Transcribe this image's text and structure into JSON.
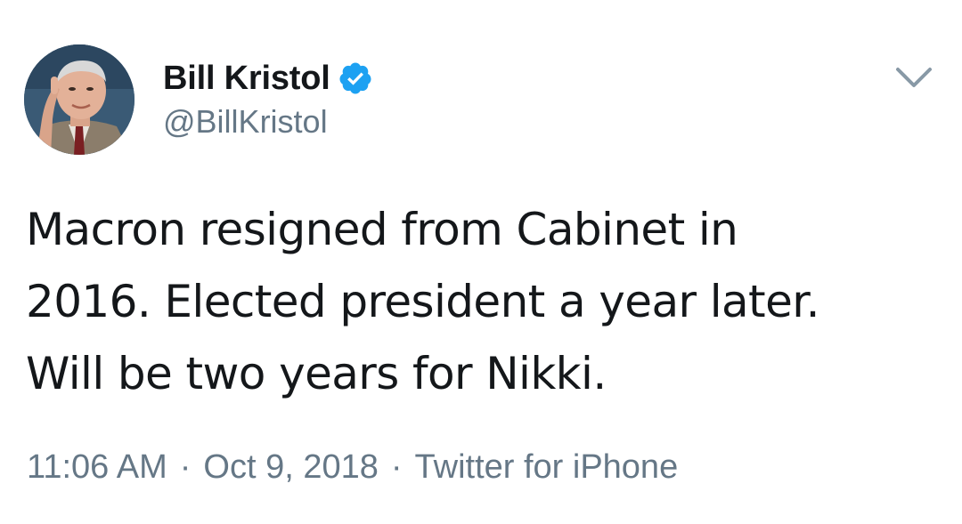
{
  "tweet": {
    "author": {
      "display_name": "Bill Kristol",
      "handle": "@BillKristol",
      "verified": true,
      "avatar": "profile-photo"
    },
    "text": "Macron resigned from Cabinet in\n2016. Elected president a year later.\nWill be two years for Nikki.",
    "time": "11:06 AM",
    "separator": "·",
    "date": "Oct 9, 2018",
    "source": "Twitter for iPhone",
    "menu_icon": "chevron-down-icon"
  },
  "colors": {
    "text_primary": "#14171a",
    "text_secondary": "#657786",
    "verified_blue": "#1da1f2",
    "background": "#ffffff"
  }
}
